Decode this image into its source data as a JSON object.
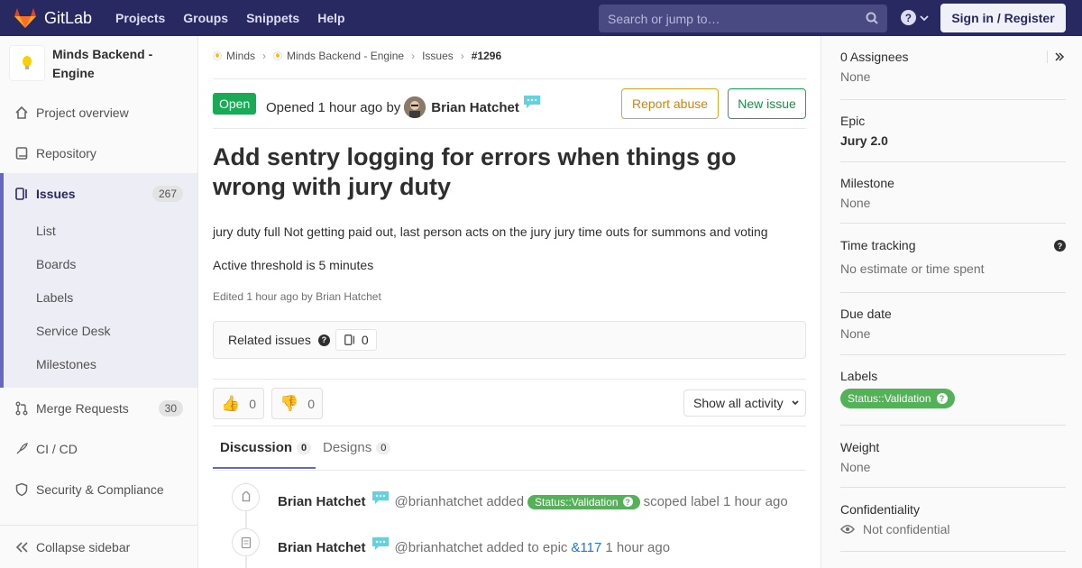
{
  "navbar": {
    "brand": "GitLab",
    "links": [
      "Projects",
      "Groups",
      "Snippets",
      "Help"
    ],
    "search_placeholder": "Search or jump to…",
    "signin_label": "Sign in / Register"
  },
  "sidebar": {
    "project_name": "Minds Backend - Engine",
    "items": [
      {
        "label": "Project overview"
      },
      {
        "label": "Repository"
      },
      {
        "label": "Issues",
        "count": "267"
      },
      {
        "label": "Merge Requests",
        "count": "30"
      },
      {
        "label": "CI / CD"
      },
      {
        "label": "Security & Compliance"
      }
    ],
    "issue_subitems": [
      "List",
      "Boards",
      "Labels",
      "Service Desk",
      "Milestones"
    ],
    "collapse_label": "Collapse sidebar"
  },
  "breadcrumb": [
    "Minds",
    "Minds Backend - Engine",
    "Issues",
    "#1296"
  ],
  "issue": {
    "status": "Open",
    "opened_text": "Opened 1 hour ago by",
    "author": "Brian Hatchet",
    "report_label": "Report abuse",
    "new_issue_label": "New issue",
    "title": "Add sentry logging for errors when things go wrong with jury duty",
    "description": "jury duty full Not getting paid out, last person acts on the jury jury time outs for summons and voting",
    "description2": "Active threshold is 5 minutes",
    "edited": "Edited 1 hour ago by Brian Hatchet",
    "related_label": "Related issues",
    "related_count": "0",
    "thumbs_up": "0",
    "thumbs_down": "0",
    "activity_filter": "Show all activity"
  },
  "tabs": [
    {
      "label": "Discussion",
      "count": "0"
    },
    {
      "label": "Designs",
      "count": "0"
    }
  ],
  "events": [
    {
      "who": "Brian Hatchet",
      "handle": "@brianhatchet",
      "action": "added",
      "label": "Status::Validation",
      "rest": "scoped label 1 hour ago"
    },
    {
      "who": "Brian Hatchet",
      "handle": "@brianhatchet",
      "action": "added to epic",
      "link": "&117",
      "rest": "1 hour ago"
    }
  ],
  "right_panel": {
    "assignees_title": "0 Assignees",
    "assignees_value": "None",
    "epic_title": "Epic",
    "epic_value": "Jury 2.0",
    "milestone_title": "Milestone",
    "milestone_value": "None",
    "time_title": "Time tracking",
    "time_value": "No estimate or time spent",
    "due_title": "Due date",
    "due_value": "None",
    "labels_title": "Labels",
    "label_value": "Status::Validation",
    "weight_title": "Weight",
    "weight_value": "None",
    "confidentiality_title": "Confidentiality",
    "confidentiality_value": "Not confidential"
  },
  "colors": {
    "navbar": "#292961",
    "open_green": "#1aaa55",
    "label_green": "#53b157",
    "accent": "#6666c4"
  }
}
